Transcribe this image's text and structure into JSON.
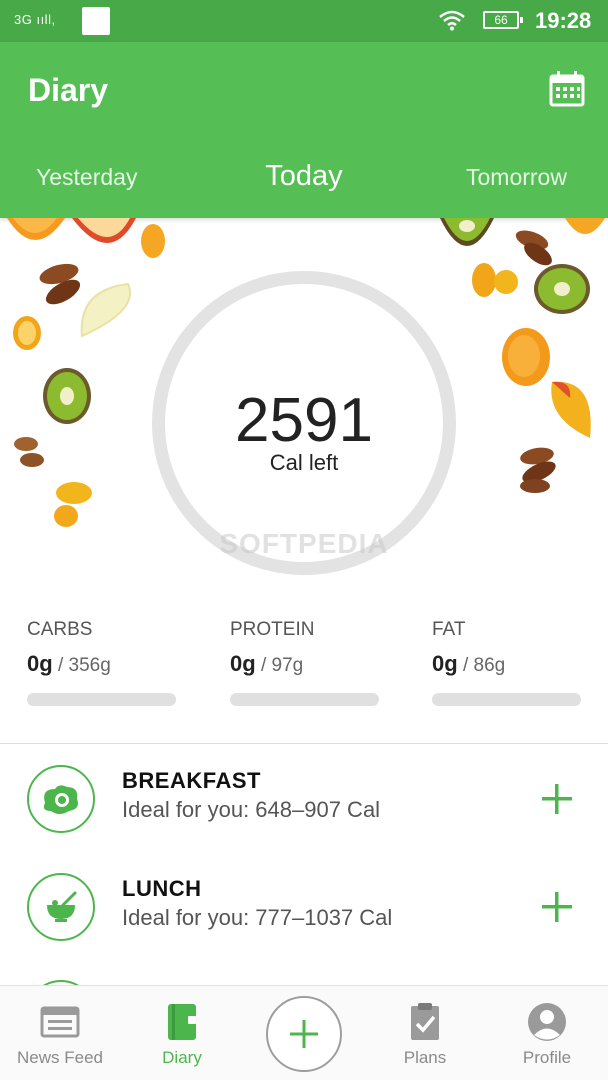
{
  "status_bar": {
    "network": "3G",
    "battery": "66",
    "time": "19:28"
  },
  "app_bar": {
    "title": "Diary",
    "calendar_icon": "calendar-icon",
    "tabs": {
      "yesterday": "Yesterday",
      "today": "Today",
      "tomorrow": "Tomorrow"
    }
  },
  "calories": {
    "value": "2591",
    "label": "Cal left"
  },
  "watermark": "SOFTPEDIA",
  "macros": [
    {
      "name": "CARBS",
      "current": "0g",
      "target": " / 356g",
      "progress": 0
    },
    {
      "name": "PROTEIN",
      "current": "0g",
      "target": " / 97g",
      "progress": 0
    },
    {
      "name": "FAT",
      "current": "0g",
      "target": " / 86g",
      "progress": 0
    }
  ],
  "meals": [
    {
      "name": "BREAKFAST",
      "ideal": "Ideal for you: 648–907 Cal",
      "icon": "fried-egg-icon"
    },
    {
      "name": "LUNCH",
      "ideal": "Ideal for you: 777–1037 Cal",
      "icon": "salad-bowl-icon"
    }
  ],
  "bottom_nav": {
    "news_feed": "News Feed",
    "diary": "Diary",
    "plans": "Plans",
    "profile": "Profile",
    "active": "diary"
  },
  "colors": {
    "primary": "#55bf55",
    "status_bar": "#48a948",
    "accent": "#4cb64c"
  }
}
